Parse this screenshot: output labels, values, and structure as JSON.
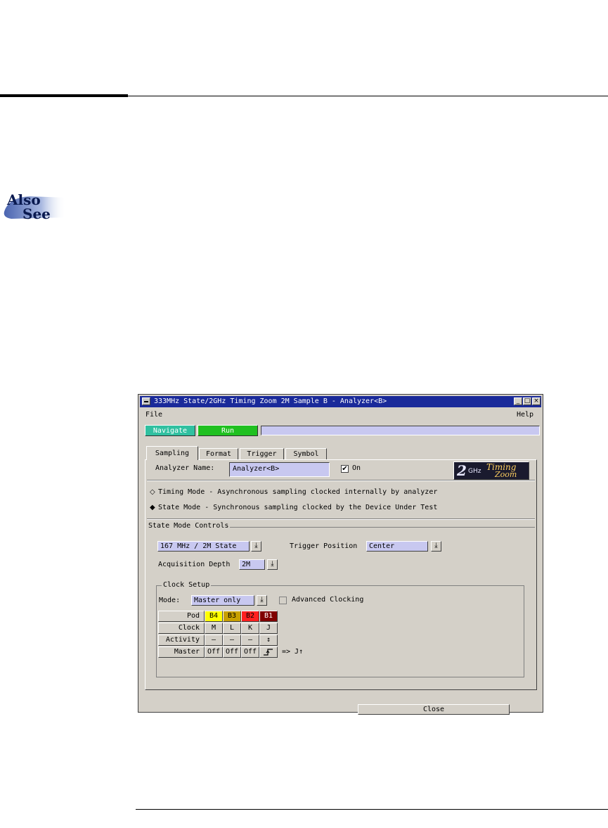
{
  "window": {
    "title": "333MHz State/2GHz Timing Zoom 2M Sample B - Analyzer<B>",
    "controls": {
      "minimize": "_",
      "maximize": "□",
      "close": "×"
    }
  },
  "menu": {
    "file": "File",
    "help": "Help"
  },
  "nav": {
    "navigate_label": "Navigate",
    "navigate_color": "#30c0a0",
    "run_label": "Run",
    "run_color": "#20c020"
  },
  "tabs": [
    "Sampling",
    "Format",
    "Trigger",
    "Symbol"
  ],
  "sampling": {
    "analyzer_name_label": "Analyzer Name:",
    "analyzer_name_value": "Analyzer<B>",
    "on_label": "On",
    "on_checked": true,
    "logo": {
      "big": "2",
      "unit": "GHz",
      "line1": "Timing",
      "line2": "Zoom"
    },
    "timing_mode": "Timing Mode - Asynchronous sampling clocked internally by analyzer",
    "state_mode": "State Mode  - Synchronous sampling clocked by the Device Under Test",
    "state_controls_title": "State Mode Controls",
    "state_speed": "167 MHz / 2M State",
    "trigger_position_label": "Trigger Position",
    "trigger_position_value": "Center",
    "acq_depth_label": "Acquisition Depth",
    "acq_depth_value": "2M",
    "clock_setup_title": "Clock Setup",
    "mode_label": "Mode:",
    "mode_value": "Master only",
    "advanced_clocking_label": "Advanced Clocking",
    "pod_table": {
      "row_labels": [
        "Pod",
        "Clock",
        "Activity",
        "Master"
      ],
      "pods": [
        "B4",
        "B3",
        "B2",
        "B1"
      ],
      "pod_colors": [
        "#ffff00",
        "#c8a000",
        "#ff2020",
        "#800000"
      ],
      "pod_text_colors": [
        "#000000",
        "#000000",
        "#000000",
        "#ffffff"
      ],
      "clocks": [
        "M",
        "L",
        "K",
        "J"
      ],
      "activity": [
        "–",
        "–",
        "–",
        "↕"
      ],
      "master": [
        "Off",
        "Off",
        "Off",
        "rising-edge-icon"
      ],
      "master_result": "=> J↑"
    }
  },
  "footer": {
    "close_label": "Close"
  },
  "doc": {
    "also_see_1": "Also",
    "also_see_2": "See"
  }
}
